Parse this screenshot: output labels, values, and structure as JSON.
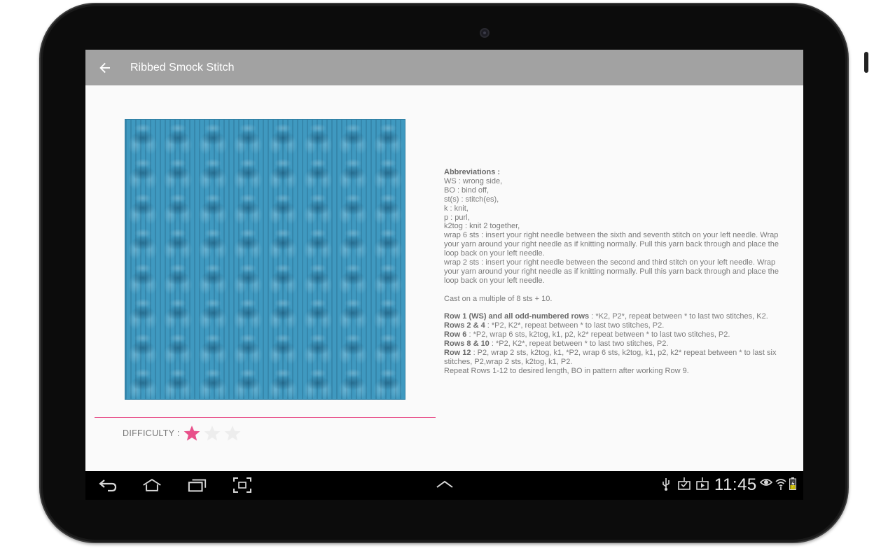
{
  "appbar": {
    "title": "Ribbed Smock Stitch"
  },
  "difficulty": {
    "label": "DIFFICULTY :",
    "rating": 1,
    "max": 3
  },
  "instructions": {
    "abbrev_header": "Abbreviations :",
    "abbreviations": [
      "WS : wrong side,",
      "BO : bind off,",
      "st(s) : stitch(es),",
      "k : knit,",
      "p : purl,",
      "k2tog : knit 2 together,",
      "wrap 6 sts : insert your right needle between the sixth and seventh stitch on your left needle. Wrap",
      "your yarn around your right needle as if knitting normally. Pull this yarn back through and place the",
      "loop back on your left needle.",
      "wrap 2 sts : insert your right needle between the second and third stitch on your left needle. Wrap",
      "your yarn around your right needle as if knitting normally. Pull this yarn back through and place the",
      "loop back on your left needle."
    ],
    "cast_on": "Cast on a multiple of 8 sts + 10.",
    "rows": [
      {
        "label": "Row 1 (WS) and all odd-numbered rows",
        "text": " : *K2, P2*, repeat between * to last two stitches, K2."
      },
      {
        "label": "Rows 2 & 4",
        "text": " : *P2, K2*, repeat between * to last two stitches, P2."
      },
      {
        "label": "Row 6",
        "text": " : *P2, wrap 6 sts, k2tog, k1, p2, k2* repeat between * to last two stitches, P2."
      },
      {
        "label": "Rows 8 & 10",
        "text": " : *P2, K2*, repeat between * to last two stitches, P2."
      },
      {
        "label": "Row 12",
        "text": " : P2, wrap 2 sts, k2tog, k1, *P2, wrap 6 sts, k2tog, k1, p2, k2* repeat between * to last six"
      }
    ],
    "row12_cont": "stitches, P2,wrap 2 sts, k2tog, k1, P2.",
    "repeat_note": "Repeat Rows 1-12 to desired length, BO in pattern after working Row 9."
  },
  "statusbar": {
    "time": "11:45"
  },
  "colors": {
    "appbar": "#a2a2a2",
    "accent": "#e8508a",
    "yarn": "#3f99c0"
  },
  "icons": {
    "back": "arrow-back-icon",
    "nav_back": "nav-back-icon",
    "nav_home": "nav-home-icon",
    "nav_recents": "nav-recents-icon",
    "nav_screenshot": "nav-screenshot-icon",
    "nav_up": "nav-up-chevron-icon"
  }
}
